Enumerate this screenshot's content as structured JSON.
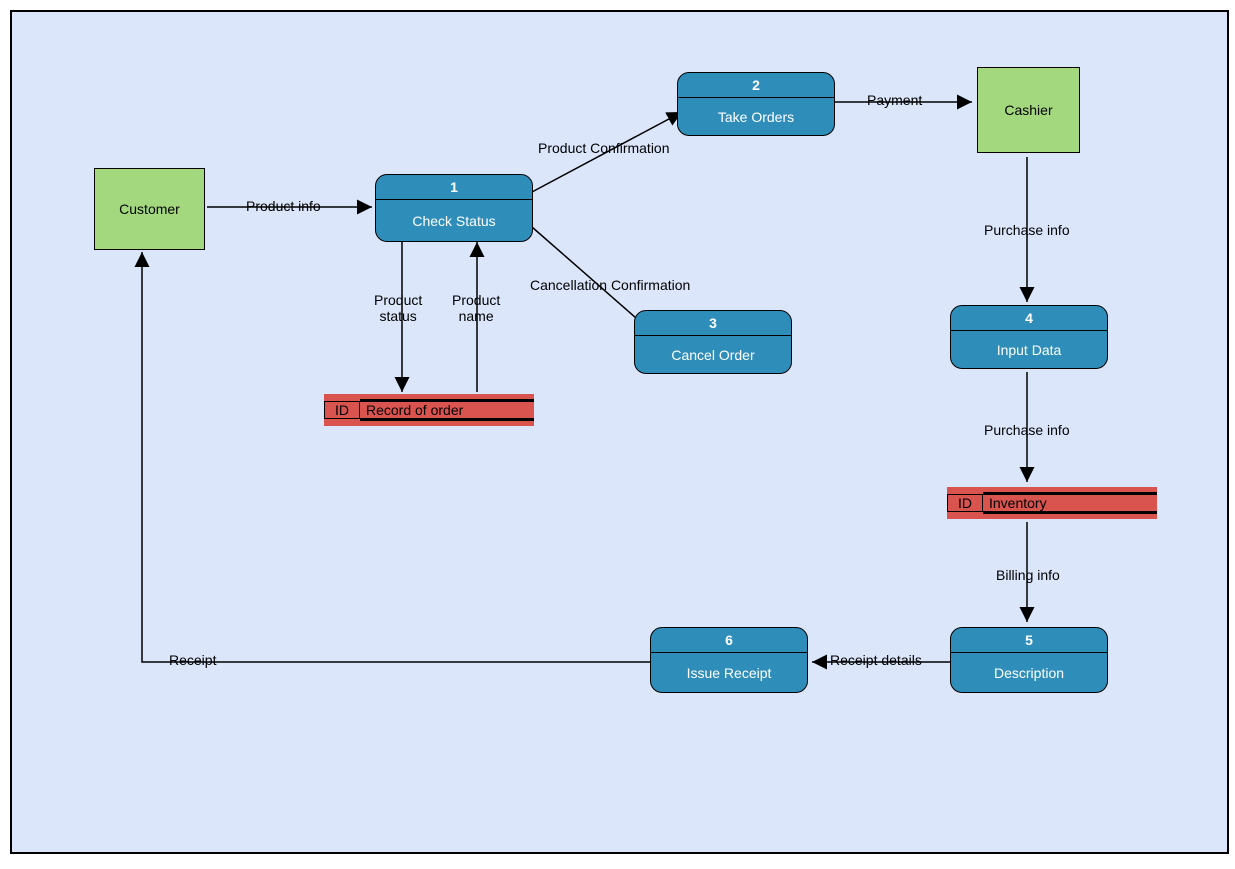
{
  "entities": {
    "customer": "Customer",
    "cashier": "Cashier"
  },
  "processes": {
    "1": {
      "num": "1",
      "label": "Check Status"
    },
    "2": {
      "num": "2",
      "label": "Take Orders"
    },
    "3": {
      "num": "3",
      "label": "Cancel Order"
    },
    "4": {
      "num": "4",
      "label": "Input Data"
    },
    "5": {
      "num": "5",
      "label": "Description"
    },
    "6": {
      "num": "6",
      "label": "Issue Receipt"
    }
  },
  "stores": {
    "recordOrder": {
      "id": "ID",
      "name": "Record of order"
    },
    "inventory": {
      "id": "ID",
      "name": "Inventory"
    }
  },
  "flows": {
    "productInfo": "Product info",
    "productConfirmation": "Product Confirmation",
    "cancellationConfirmation": "Cancellation Confirmation",
    "productStatus": "Product\nstatus",
    "productName": "Product\nname",
    "payment": "Payment",
    "purchaseInfo1": "Purchase info",
    "purchaseInfo2": "Purchase info",
    "billingInfo": "Billing info",
    "receiptDetails": "Receipt details",
    "receipt": "Receipt"
  }
}
